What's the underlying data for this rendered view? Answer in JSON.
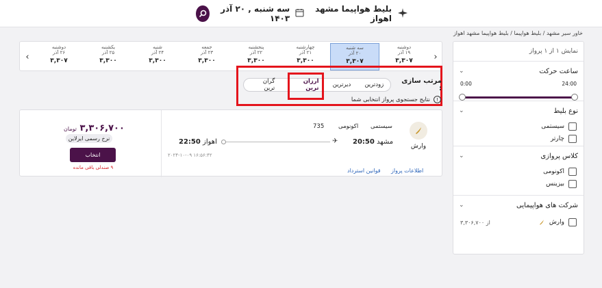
{
  "header": {
    "title": "بلیط هواپیما مشهد اهواز",
    "date": "سه شنبه , ۲۰ آذر ۱۴۰۳"
  },
  "breadcrumb": "خاور سیر مشهد / بلیط هواپیما / بلیط هواپیما مشهد اهواز",
  "date_bar": {
    "days": [
      {
        "name": "دوشنبه",
        "date": "۱۹ آذر",
        "price": "۳,۳۰۷",
        "selected": false
      },
      {
        "name": "سه شنبه",
        "date": "۲۰ آذر",
        "price": "۳,۳۰۷",
        "selected": true
      },
      {
        "name": "چهارشنبه",
        "date": "۲۱ آذر",
        "price": "۳,۳۰۰",
        "selected": false
      },
      {
        "name": "پنجشنبه",
        "date": "۲۲ آذر",
        "price": "۳,۳۰۰",
        "selected": false
      },
      {
        "name": "جمعه",
        "date": "۲۳ آذر",
        "price": "۳,۳۰۰",
        "selected": false
      },
      {
        "name": "شنبه",
        "date": "۲۴ آذر",
        "price": "۳,۳۰۰",
        "selected": false
      },
      {
        "name": "یکشنبه",
        "date": "۲۵ آذر",
        "price": "۳,۳۰۰",
        "selected": false
      },
      {
        "name": "دوشنبه",
        "date": "۲۶ آذر",
        "price": "۳,۳۰۷",
        "selected": false
      }
    ]
  },
  "sort": {
    "label": "مرتب سازی :",
    "options": [
      "زودترین",
      "دیرترین",
      "ارزان ترین",
      "گران ترین"
    ],
    "active": "ارزان ترین"
  },
  "notice": "نتایج جستجوی پرواز انتخابی شما",
  "flight": {
    "airline": "وارش",
    "type": "سیستمی",
    "class": "اکونومی",
    "aircraft": "735",
    "from_city": "مشهد",
    "from_time": "20:50",
    "to_city": "اهواز",
    "to_time": "22:50",
    "timestamp": "۲۰۲۴-۱۰-۰۹ ۱۶:۵۶:۴۲",
    "link_info": "اطلاعات پرواز",
    "link_refund": "قوانین استرداد",
    "price": "۳,۳۰۶,۷۰۰",
    "currency": "تومان",
    "fare_badge": "نرخ رسمی ایرلاین",
    "select_label": "انتخاب",
    "seats_left": "۹ صندلی باقی مانده"
  },
  "sidebar": {
    "count": "نمایش ۱ از ۱ پرواز",
    "departure": {
      "title": "ساعت حرکت",
      "min": "0:00",
      "max": "24:00"
    },
    "ticket_type": {
      "title": "نوع بلیط",
      "options": [
        "سیستمی",
        "چارتر"
      ]
    },
    "flight_class": {
      "title": "کلاس پروازی",
      "options": [
        "اکونومی",
        "بیزینس"
      ]
    },
    "airlines": {
      "title": "شرکت های هواپیمایی",
      "item_name": "وارش",
      "item_price": "از ۳,۳۰۶,۷۰۰"
    }
  },
  "colors": {
    "accent": "#4b1249",
    "selected_day": "#c9dcf8",
    "highlight": "#e4141c",
    "link": "#2962b8"
  },
  "icons": [
    "plane-icon",
    "calendar-icon",
    "search-icon",
    "chevron-left-icon",
    "chevron-right-icon",
    "info-icon",
    "airline-logo-icon",
    "chevron-down-icon"
  ]
}
